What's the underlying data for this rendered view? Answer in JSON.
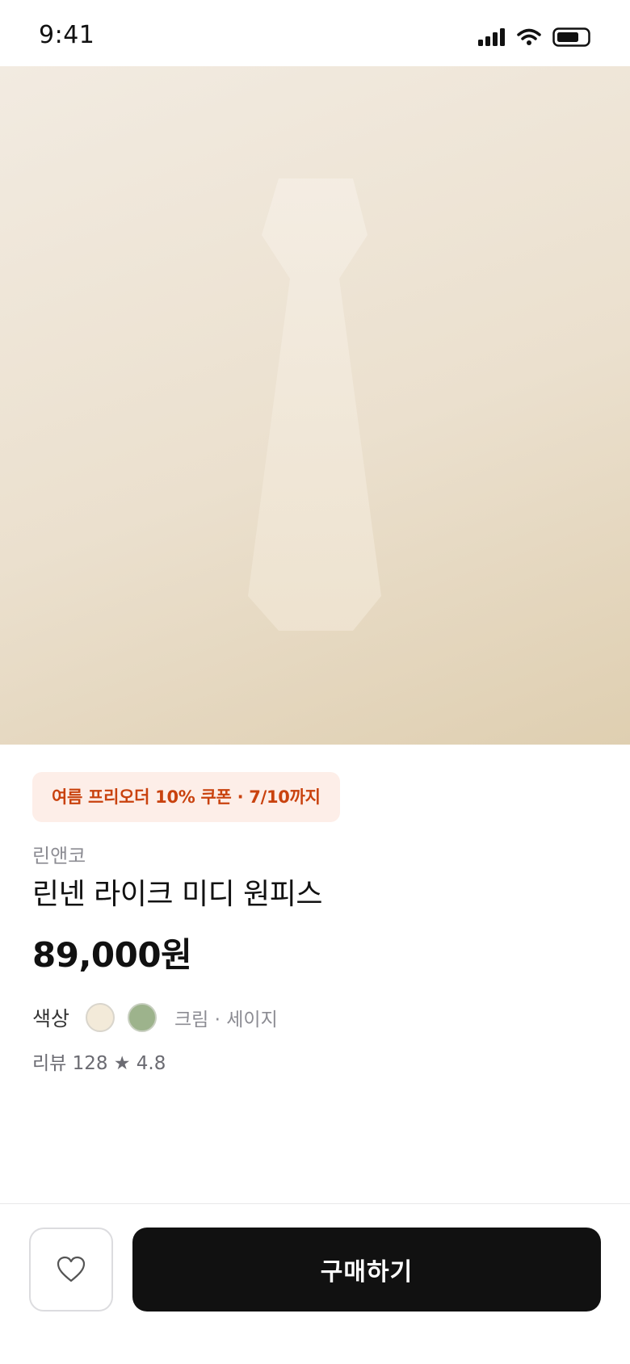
{
  "status_bar": {
    "time": "9:41"
  },
  "promo": {
    "coupon_text": "여름 프리오더 10% 쿠폰 · 7/10까지"
  },
  "product": {
    "brand": "린앤코",
    "name": "린넨 라이크 미디 원피스",
    "price": "89,000원",
    "color_label": "색상",
    "colors": [
      {
        "name": "크림",
        "hex": "#f3ead9"
      },
      {
        "name": "세이지",
        "hex": "#9db38c"
      }
    ],
    "color_names": "크림 · 세이지",
    "reviews": "리뷰 128 ★ 4.8"
  },
  "actions": {
    "wish_icon": "heart-outline-icon",
    "buy_label": "구매하기"
  },
  "theme": {
    "coupon_bg": "#fdeee8",
    "coupon_text": "#c9420e",
    "buy_bg": "#111111"
  }
}
